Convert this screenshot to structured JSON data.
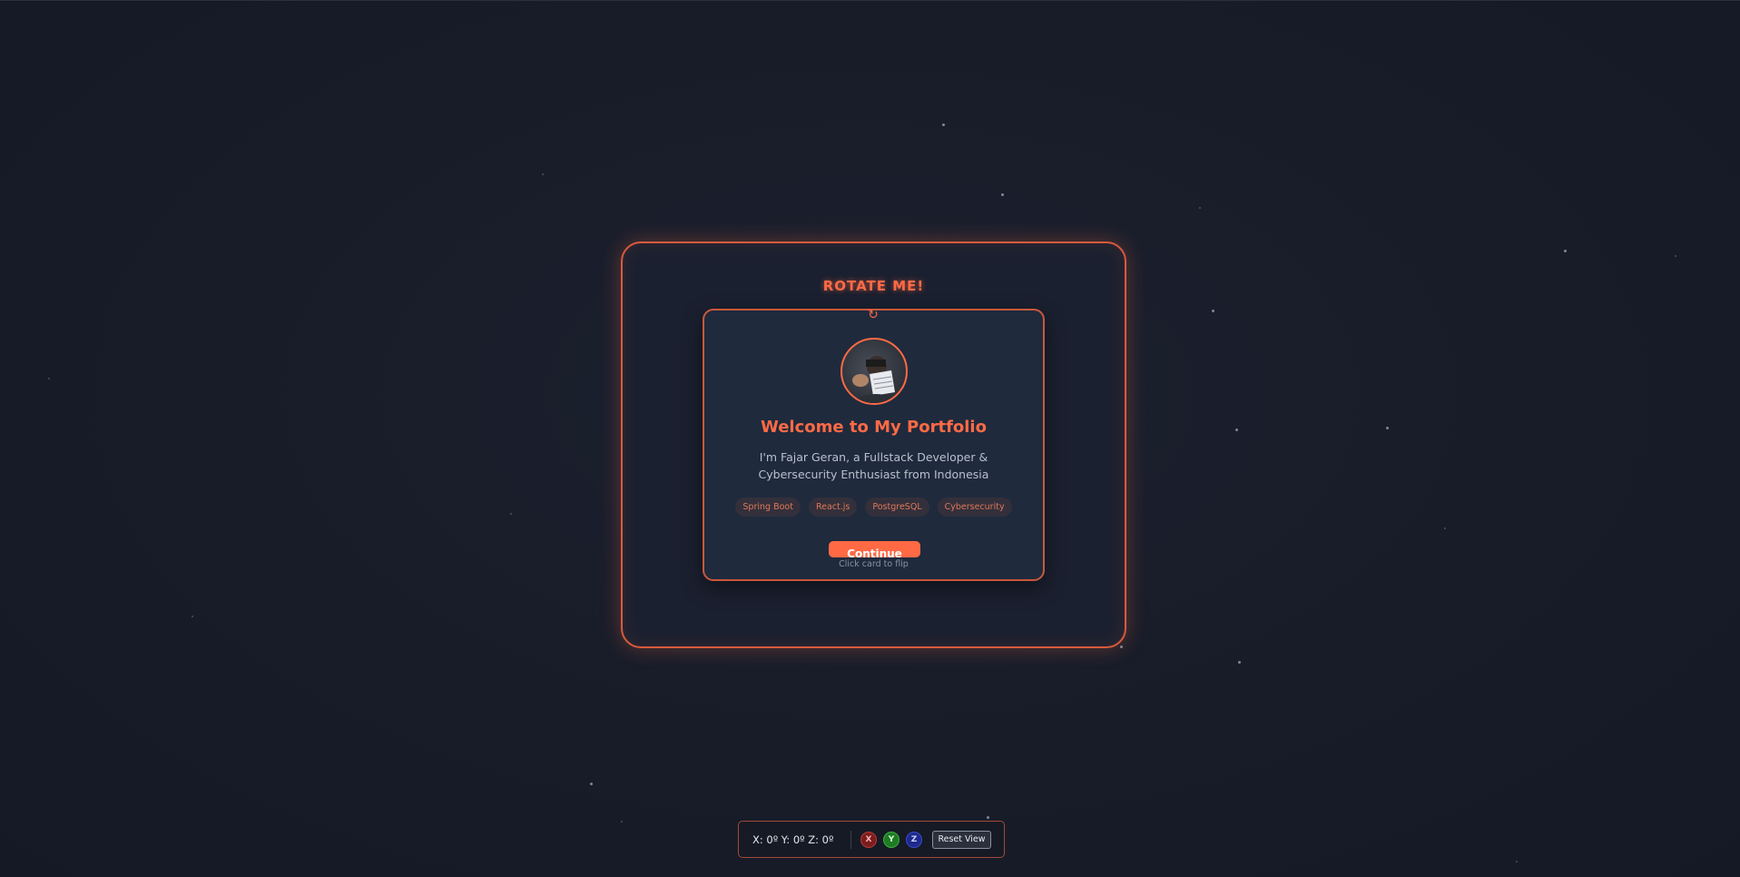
{
  "stage": {
    "rotate_label": "ROTATE ME!",
    "rotate_icon": "↻"
  },
  "card": {
    "avatar_icon": "profile-photo",
    "title": "Welcome to My Portfolio",
    "description": "I'm Fajar Geran, a Fullstack Developer & Cybersecurity Enthusiast from Indonesia",
    "tags": [
      "Spring Boot",
      "React.js",
      "PostgreSQL",
      "Cybersecurity"
    ],
    "continue_label": "Continue",
    "flip_hint": "Click card to flip"
  },
  "controls": {
    "rotation_readout": "X: 0º Y: 0º Z: 0º",
    "axis_x": "X",
    "axis_y": "Y",
    "axis_z": "Z",
    "reset_label": "Reset View"
  },
  "colors": {
    "accent": "#ff6a45",
    "background": "#181c28",
    "card": "#1f2a3d"
  }
}
